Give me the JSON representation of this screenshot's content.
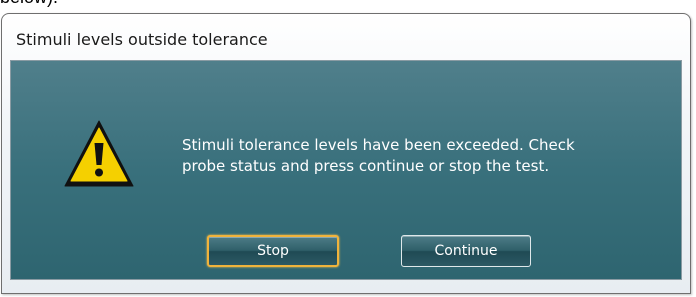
{
  "page": {
    "top_fragment": "below)."
  },
  "dialog": {
    "title": "Stimuli levels outside tolerance",
    "icon": "warning-icon",
    "message_lines": [
      "Stimuli tolerance levels have been exceeded. Check",
      "probe status and press continue or stop the test."
    ],
    "buttons": {
      "stop_label": "Stop",
      "continue_label": "Continue"
    }
  },
  "colors": {
    "panel": "#39707c",
    "icon_fill": "#f5d000",
    "focus_border": "#f0b33c",
    "text": "#ffffff"
  }
}
